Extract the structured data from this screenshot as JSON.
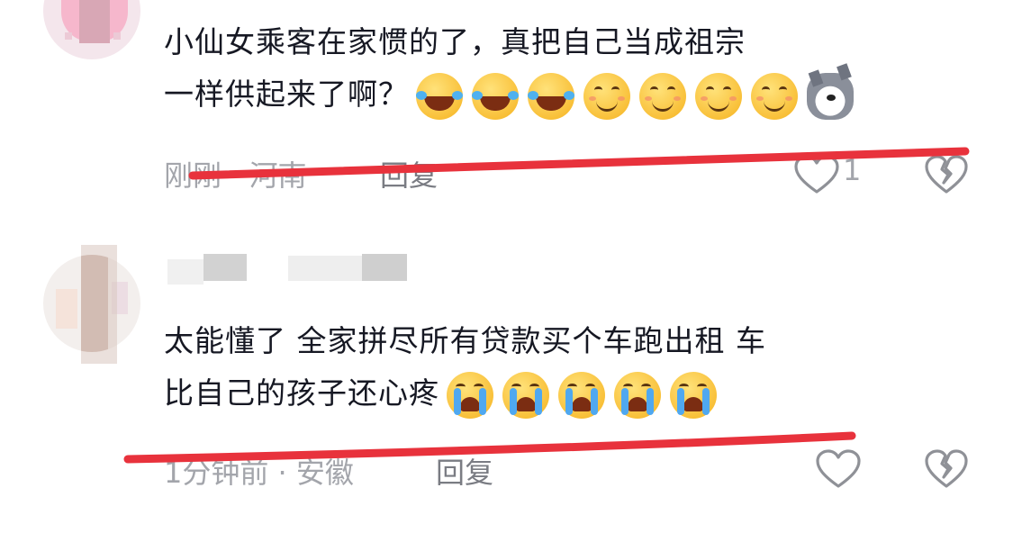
{
  "comments": [
    {
      "text_lines": [
        "小仙女乘客在家惯的了，真把自己当成祖宗",
        "一样供起来了啊？"
      ],
      "emojis": [
        "laugh-cry-icon",
        "laugh-cry-icon",
        "laugh-cry-icon",
        "smile-icon",
        "smile-icon",
        "smile-icon",
        "smile-icon",
        "husky-dog-icon"
      ],
      "time": "刚刚",
      "location": "河南",
      "separator": "·",
      "reply_label": "回复",
      "like_count": "1"
    },
    {
      "text_lines": [
        "太能懂了 全家拼尽所有贷款买个车跑出租 车",
        "比自己的孩子还心疼"
      ],
      "emojis": [
        "crying-icon",
        "crying-icon",
        "crying-icon",
        "crying-icon",
        "crying-icon"
      ],
      "time": "1分钟前",
      "location": "安徽",
      "separator": "·",
      "reply_label": "回复",
      "like_count": ""
    }
  ],
  "colors": {
    "underline": "#e8323c",
    "meta_text": "#a3a5ab",
    "icon_stroke": "#8f9197"
  }
}
